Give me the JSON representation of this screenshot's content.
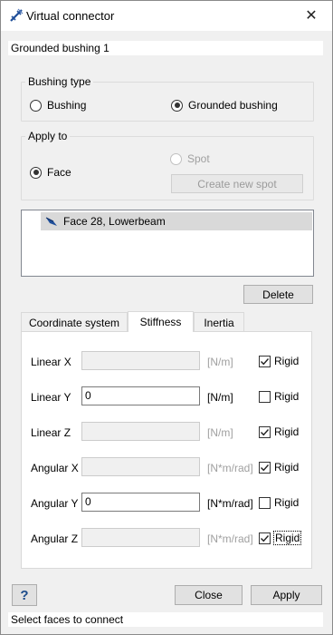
{
  "window": {
    "title": "Virtual connector",
    "close_glyph": "✕"
  },
  "name_field": {
    "value": "Grounded bushing 1"
  },
  "bushing_type": {
    "label": "Bushing type",
    "options": [
      {
        "label": "Bushing",
        "checked": false
      },
      {
        "label": "Grounded bushing",
        "checked": true
      }
    ]
  },
  "apply_to": {
    "label": "Apply to",
    "options": [
      {
        "label": "Face",
        "checked": true,
        "enabled": true
      },
      {
        "label": "Spot",
        "checked": false,
        "enabled": false
      }
    ],
    "create_spot_label": "Create new spot"
  },
  "selection_list": {
    "items": [
      {
        "label": "Face 28, Lowerbeam",
        "icon": "face-icon"
      }
    ]
  },
  "delete_label": "Delete",
  "tabs": [
    {
      "label": "Coordinate system",
      "active": false
    },
    {
      "label": "Stiffness",
      "active": true
    },
    {
      "label": "Inertia",
      "active": false
    }
  ],
  "stiffness_rows": [
    {
      "label": "Linear X",
      "value": "",
      "unit": "[N/m]",
      "rigid_label": "Rigid",
      "rigid": true
    },
    {
      "label": "Linear Y",
      "value": "0",
      "unit": "[N/m]",
      "rigid_label": "Rigid",
      "rigid": false
    },
    {
      "label": "Linear Z",
      "value": "",
      "unit": "[N/m]",
      "rigid_label": "Rigid",
      "rigid": true
    },
    {
      "label": "Angular X",
      "value": "",
      "unit": "[N*m/rad]",
      "rigid_label": "Rigid",
      "rigid": true
    },
    {
      "label": "Angular Y",
      "value": "0",
      "unit": "[N*m/rad]",
      "rigid_label": "Rigid",
      "rigid": false
    },
    {
      "label": "Angular Z",
      "value": "",
      "unit": "[N*m/rad]",
      "rigid_label": "Rigid",
      "rigid": true
    }
  ],
  "footer": {
    "help_label": "?",
    "close_label": "Close",
    "apply_label": "Apply"
  },
  "status": "Select faces to connect",
  "colors": {
    "accent_icon": "#1f4e99",
    "selection_bg": "#d9d9d9"
  }
}
